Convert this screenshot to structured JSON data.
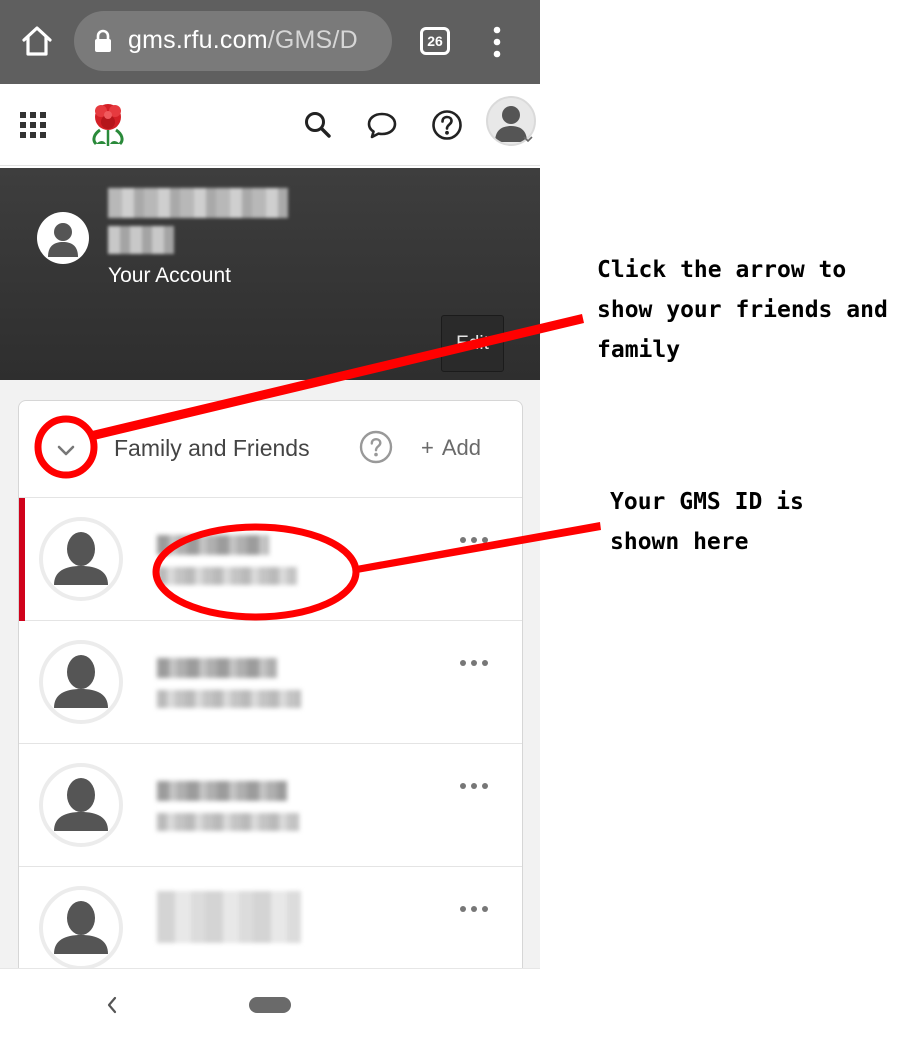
{
  "browser": {
    "url_host": "gms.rfu.com",
    "url_path": "/GMS/D",
    "tab_count": "26"
  },
  "header": {
    "icons": [
      "apps-grid-icon",
      "rfu-rose-logo",
      "search-icon",
      "chat-icon",
      "help-icon",
      "user-avatar-icon"
    ]
  },
  "account": {
    "label": "Your Account",
    "edit_label": "Edit"
  },
  "family_card": {
    "title": "Family and Friends",
    "add_label": "Add",
    "add_symbol": "+",
    "members": [
      {
        "selected": true
      },
      {
        "selected": false
      },
      {
        "selected": false
      },
      {
        "selected": false
      }
    ]
  },
  "annotations": {
    "arrow_note": "Click the arrow to\nshow your friends and\nfamily",
    "gms_note": "Your GMS ID is\nshown here",
    "color": "#ff0000"
  },
  "colors": {
    "browser_bar": "#5f5f5f",
    "account_panel": "#333333",
    "accent_red": "#d0021b"
  }
}
